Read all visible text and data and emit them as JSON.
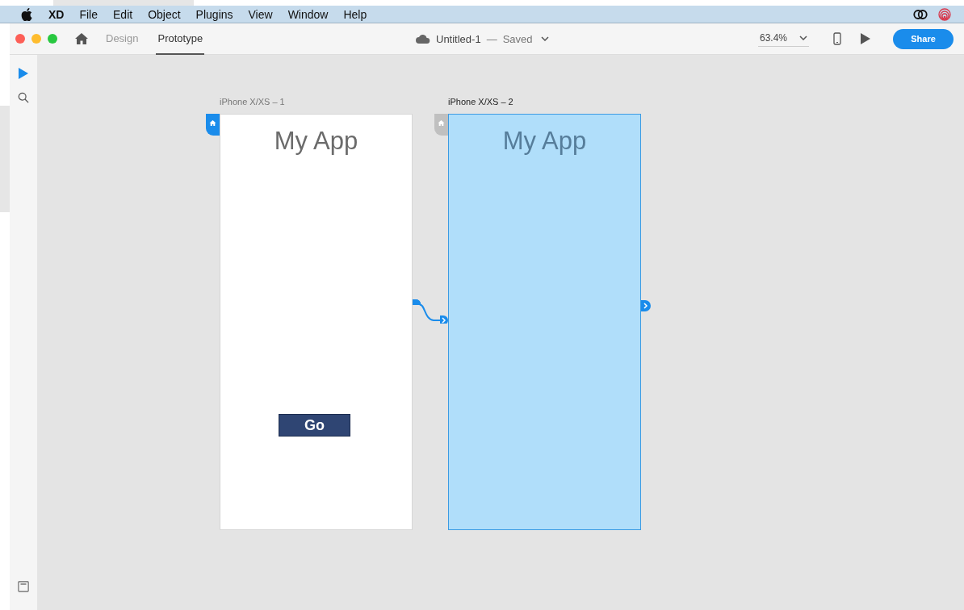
{
  "menu_bar": {
    "app_name": "XD",
    "items": [
      "File",
      "Edit",
      "Object",
      "Plugins",
      "View",
      "Window",
      "Help"
    ]
  },
  "toolbar": {
    "tabs": [
      {
        "label": "Design",
        "selected": false
      },
      {
        "label": "Prototype",
        "selected": true
      }
    ],
    "document": {
      "title": "Untitled-1",
      "separator": "—",
      "status": "Saved"
    },
    "zoom": "63.4%",
    "share_button": "Share"
  },
  "artboards": [
    {
      "name": "iPhone X/XS – 1",
      "title": "My App",
      "selected": false,
      "home": true,
      "button": "Go"
    },
    {
      "name": "iPhone X/XS – 2",
      "title": "My App",
      "selected": true,
      "home": false
    }
  ]
}
